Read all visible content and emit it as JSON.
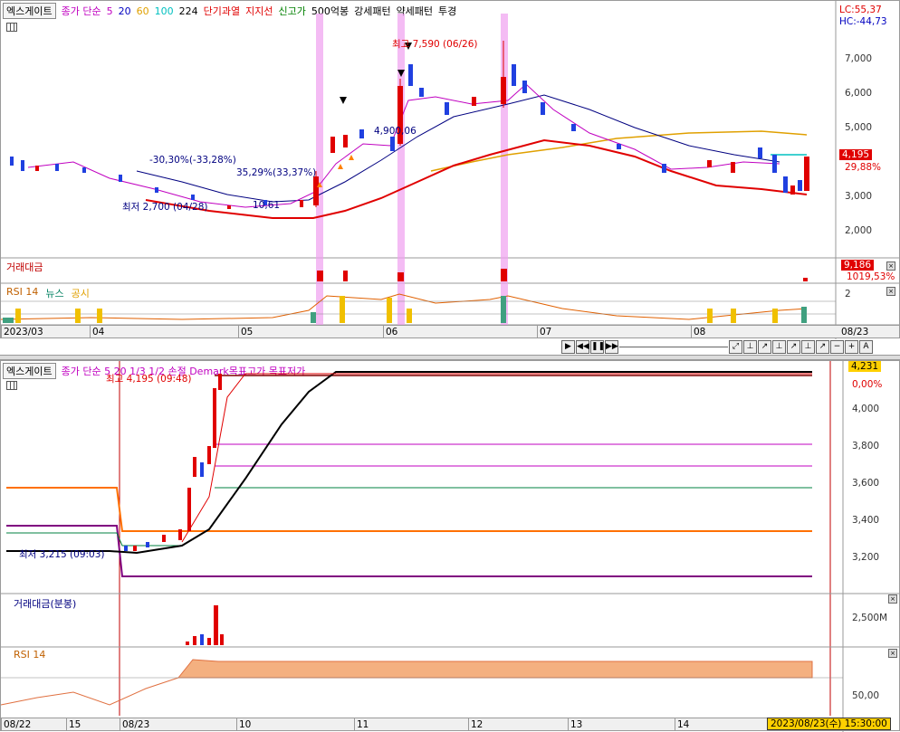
{
  "top_chart": {
    "stock_name": "엑스게이트",
    "legend": [
      {
        "label": "종가 단순",
        "color": "#c000c0"
      },
      {
        "label": "5",
        "color": "#c000c0"
      },
      {
        "label": "20",
        "color": "#0000c0"
      },
      {
        "label": "60",
        "color": "#e0a000"
      },
      {
        "label": "100",
        "color": "#00c0c0"
      },
      {
        "label": "224",
        "color": "#000000"
      },
      {
        "label": "단기과열",
        "color": "#e00000"
      },
      {
        "label": "지지선",
        "color": "#e00000"
      },
      {
        "label": "신고가",
        "color": "#008000"
      },
      {
        "label": "500억봉",
        "color": "#000000"
      },
      {
        "label": "강세패턴",
        "color": "#000000"
      },
      {
        "label": "약세패턴",
        "color": "#000000"
      },
      {
        "label": "투경",
        "color": "#000000"
      }
    ],
    "lc": "LC:55,37",
    "hc": "HC:-44,73",
    "price_ticks": [
      "7,000",
      "6,000",
      "5,000",
      "4,000",
      "3,000",
      "2,000"
    ],
    "current_price": "4,195",
    "current_pct": "29,88%",
    "annotations": {
      "high": "최고 7,590 (06/26)",
      "low": "최저 2,700 (04/28)",
      "low_pct": "10,61",
      "pct1": "-30,30%(-33,28%)",
      "pct2": "35,29%(33,37%)",
      "mid": "4,900,06"
    },
    "volume_title": "거래대금",
    "volume_value": "9,186",
    "volume_pct": "1019,53%",
    "rsi_legend": [
      "RSI 14",
      "뉴스",
      "공시"
    ],
    "rsi_tick": "2",
    "dates": [
      "2023/03",
      "04",
      "05",
      "06",
      "07",
      "08",
      "08/23"
    ]
  },
  "bottom_chart": {
    "stock_name": "엑스게이트",
    "legend_text": "종가 단순 5  20  1/3  1/2  손절  Demark목표고가  목표저가",
    "price_tag": "4,231",
    "price_pct": "0,00%",
    "price_ticks": [
      "4,000",
      "3,800",
      "3,600",
      "3,400",
      "3,200"
    ],
    "high": "최고 4,195 (09:48)",
    "low": "최저 3,215 (09:03)",
    "volume_title": "거래대금(분봉)",
    "volume_tick": "2,500M",
    "rsi_title": "RSI 14",
    "rsi_tick": "50,00",
    "dates": [
      "08/22",
      "15",
      "08/23",
      "10",
      "11",
      "12",
      "13",
      "14"
    ],
    "timestamp": "2023/08/23(수) 15:30:00"
  },
  "colors": {
    "up": "#e00000",
    "down": "#2040e0",
    "highlight": "#f0a0f0"
  }
}
